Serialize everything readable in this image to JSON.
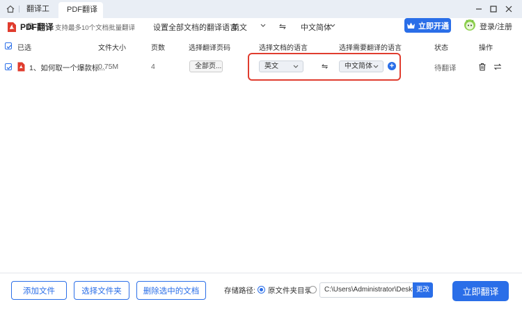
{
  "tabs": {
    "home_tab": "翻译工具",
    "active_tab": "PDF翻译",
    "close_glyph": "×"
  },
  "window_controls": {
    "minimize": "—",
    "maximize": "□",
    "close": "✕"
  },
  "header": {
    "app_name": "PDF翻译",
    "app_subtitle": "支持最多10个文档批量翻译",
    "set_all_label": "设置全部文档的翻译语言:",
    "source_lang": "英文",
    "swap_glyph": "⇋",
    "target_lang": "中文简体",
    "vip_button": "立即开通",
    "login_label": "登录/注册"
  },
  "table": {
    "columns": {
      "selected": "已选",
      "file_size": "文件大小",
      "pages": "页数",
      "page_range": "选择翻译页码",
      "doc_language": "选择文档的语言",
      "target_language": "选择需要翻译的语言",
      "status": "状态",
      "actions": "操作"
    },
    "rows": [
      {
        "name": "1、如何取一个爆款标...",
        "size": "0.75M",
        "pages": "4",
        "page_range": "全部页...",
        "source_lang": "英文",
        "swap": "⇋",
        "target_lang": "中文简体",
        "add": "+",
        "status": "待翻译",
        "checked": true
      }
    ]
  },
  "footer": {
    "add_file": "添加文件",
    "choose_folder": "选择文件夹",
    "delete_selected": "删除选中的文档",
    "storage_label": "存储路径:",
    "original_folder": "原文件夹目录",
    "custom_path": "C:\\Users\\Administrator\\Deskt...",
    "change_button": "更改",
    "translate_button": "立即翻译"
  },
  "colors": {
    "accent": "#2a6ee8",
    "highlight": "#e03c2e",
    "titlebar": "#e9eef5"
  }
}
